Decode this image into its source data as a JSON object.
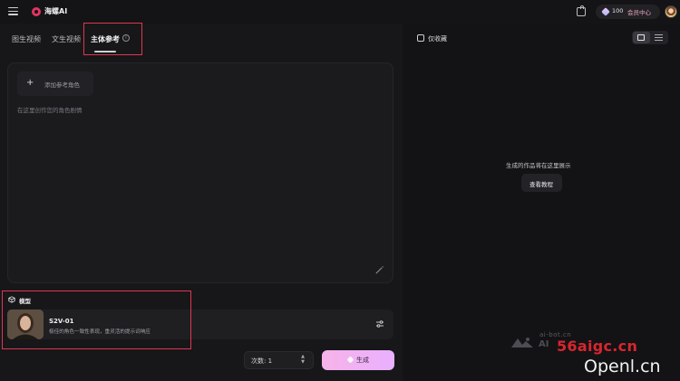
{
  "topbar": {
    "brand": "海螺AI",
    "credits": "100",
    "member_label": "会员中心"
  },
  "tabs": [
    {
      "label": "图生视频",
      "active": false
    },
    {
      "label": "文生视频",
      "active": false
    },
    {
      "label": "主体参考",
      "active": true
    }
  ],
  "prompt": {
    "add_reference_label": "添加参考角色",
    "placeholder": "在这里创作您的角色剧情"
  },
  "model": {
    "section_title": "模型",
    "name": "S2V-01",
    "description": "极佳的角色一致性表现，重灵活的提示词响应"
  },
  "generate": {
    "count_label": "次数: 1",
    "button_label": "生成"
  },
  "results": {
    "favorites_label": "仅收藏",
    "empty_text": "生成的作品将在这里展示",
    "tutorial_label": "查看教程"
  },
  "watermarks": {
    "small": "ai-bot.cn",
    "ai": "AI",
    "red": "56aigc.cn",
    "openl": "Openl.cn"
  },
  "colors": {
    "background": "#141416",
    "accent_pink": "#f7b3e8",
    "annotation_red": "#e0364f"
  }
}
